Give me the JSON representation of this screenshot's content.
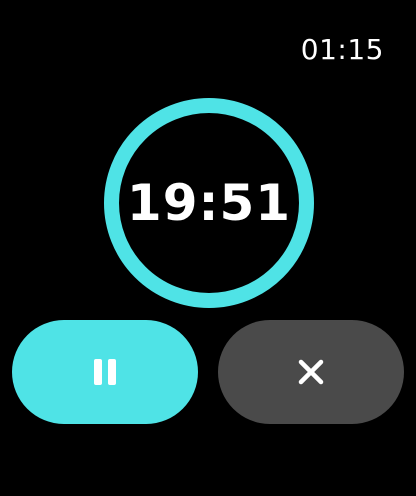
{
  "status_bar": {
    "time": "01:15"
  },
  "timer": {
    "remaining": "19:51",
    "progress_fraction": 1.0
  },
  "controls": {
    "pause_icon": "pause-icon",
    "cancel_icon": "close-icon"
  },
  "colors": {
    "accent": "#4fe3e6",
    "secondary_button": "#4a4a4a",
    "background": "#000000",
    "text": "#ffffff"
  }
}
